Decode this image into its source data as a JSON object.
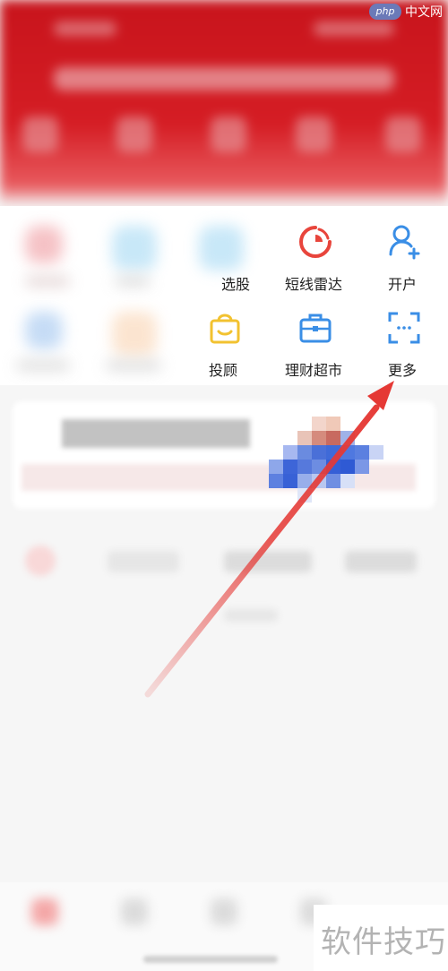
{
  "watermark": {
    "logo": "php",
    "text": "中文网"
  },
  "grid": {
    "row1": [
      {
        "label": "",
        "icon": "blurred-icon"
      },
      {
        "label": "",
        "icon": "blurred-icon"
      },
      {
        "label": "选股",
        "icon": "blurred-icon"
      },
      {
        "label": "短线雷达",
        "icon": "radar-icon",
        "color": "#e8453c"
      },
      {
        "label": "开户",
        "icon": "add-user-icon",
        "color": "#3a8ee6"
      }
    ],
    "row2": [
      {
        "label": "",
        "icon": "blurred-icon"
      },
      {
        "label": "",
        "icon": "blurred-icon"
      },
      {
        "label": "投顾",
        "icon": "shopping-bag-icon",
        "color": "#f2c230"
      },
      {
        "label": "理财超市",
        "icon": "briefcase-icon",
        "color": "#3a8ee6"
      },
      {
        "label": "更多",
        "icon": "scan-frame-icon",
        "color": "#3a8ee6"
      }
    ]
  },
  "annotation": {
    "arrow_color": "#e53935",
    "points_to": "更多"
  },
  "corner_badge": {
    "text": "软件技巧"
  }
}
